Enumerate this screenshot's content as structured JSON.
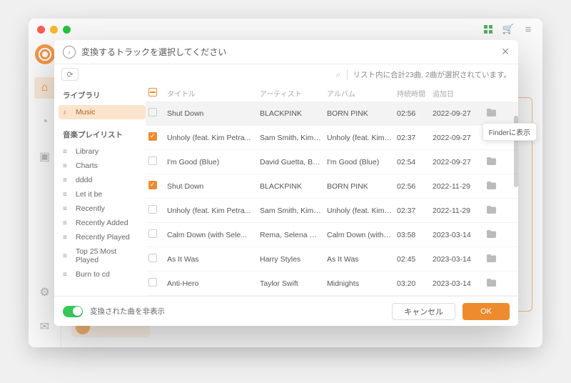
{
  "header": {
    "title": "変換するトラックを選択してください",
    "refresh_glyph": "⟳",
    "search_glyph": "⌕",
    "status_text": "リスト内に合計23曲, 2曲が選択されています。",
    "close_glyph": "✕"
  },
  "sidebar": {
    "section1_title": "ライブラリ",
    "section1_items": [
      {
        "label": "Music",
        "icon": "♪",
        "selected": true
      }
    ],
    "section2_title": "音楽プレイリスト",
    "section2_items": [
      {
        "label": "Library",
        "icon": "≡"
      },
      {
        "label": "Charts",
        "icon": "≡"
      },
      {
        "label": "dddd",
        "icon": "≡"
      },
      {
        "label": "Let it be",
        "icon": "≡"
      },
      {
        "label": "Recently",
        "icon": "≡"
      },
      {
        "label": "Recently Added",
        "icon": "≡"
      },
      {
        "label": "Recently Played",
        "icon": "≡"
      },
      {
        "label": "Top 25 Most Played",
        "icon": "≡"
      },
      {
        "label": "Burn to cd",
        "icon": "≡"
      }
    ]
  },
  "table": {
    "columns": {
      "title": "タイトル",
      "artist": "アーティスト",
      "album": "アルバム",
      "duration": "持続時間",
      "added": "追加日"
    },
    "rows": [
      {
        "checked": false,
        "title": "Shut Down",
        "artist": "BLACKPINK",
        "album": "BORN PINK",
        "duration": "02:56",
        "added": "2022-09-27",
        "hover": true
      },
      {
        "checked": true,
        "title": "Unholy (feat. Kim Petra...",
        "artist": "Sam Smith, Kim Pe...",
        "album": "Unholy (feat. Kim P...",
        "duration": "02:37",
        "added": "2022-09-27"
      },
      {
        "checked": false,
        "title": "I'm Good (Blue)",
        "artist": "David Guetta, Beb...",
        "album": "I'm Good (Blue)",
        "duration": "02:54",
        "added": "2022-09-27"
      },
      {
        "checked": true,
        "title": "Shut Down",
        "artist": "BLACKPINK",
        "album": "BORN PINK",
        "duration": "02:56",
        "added": "2022-11-29"
      },
      {
        "checked": false,
        "title": "Unholy (feat. Kim Petra...",
        "artist": "Sam Smith, Kim Pe...",
        "album": "Unholy (feat. Kim P...",
        "duration": "02:37",
        "added": "2022-11-29"
      },
      {
        "checked": false,
        "title": "Calm Down (with Sele...",
        "artist": "Rema, Selena Gom...",
        "album": "Calm Down (with S...",
        "duration": "03:58",
        "added": "2023-03-14"
      },
      {
        "checked": false,
        "title": "As It Was",
        "artist": "Harry Styles",
        "album": "As It Was",
        "duration": "02:45",
        "added": "2023-03-14"
      },
      {
        "checked": false,
        "title": "Anti-Hero",
        "artist": "Taylor Swift",
        "album": "Midnights",
        "duration": "03:20",
        "added": "2023-03-14"
      }
    ]
  },
  "footer": {
    "toggle_label": "変換された曲を非表示",
    "cancel": "キャンセル",
    "ok": "OK"
  },
  "tooltip": "Finderに表示",
  "icons": {
    "folder_glyph": "■",
    "music_glyph": "♪"
  },
  "bg": {
    "card_label": ""
  }
}
